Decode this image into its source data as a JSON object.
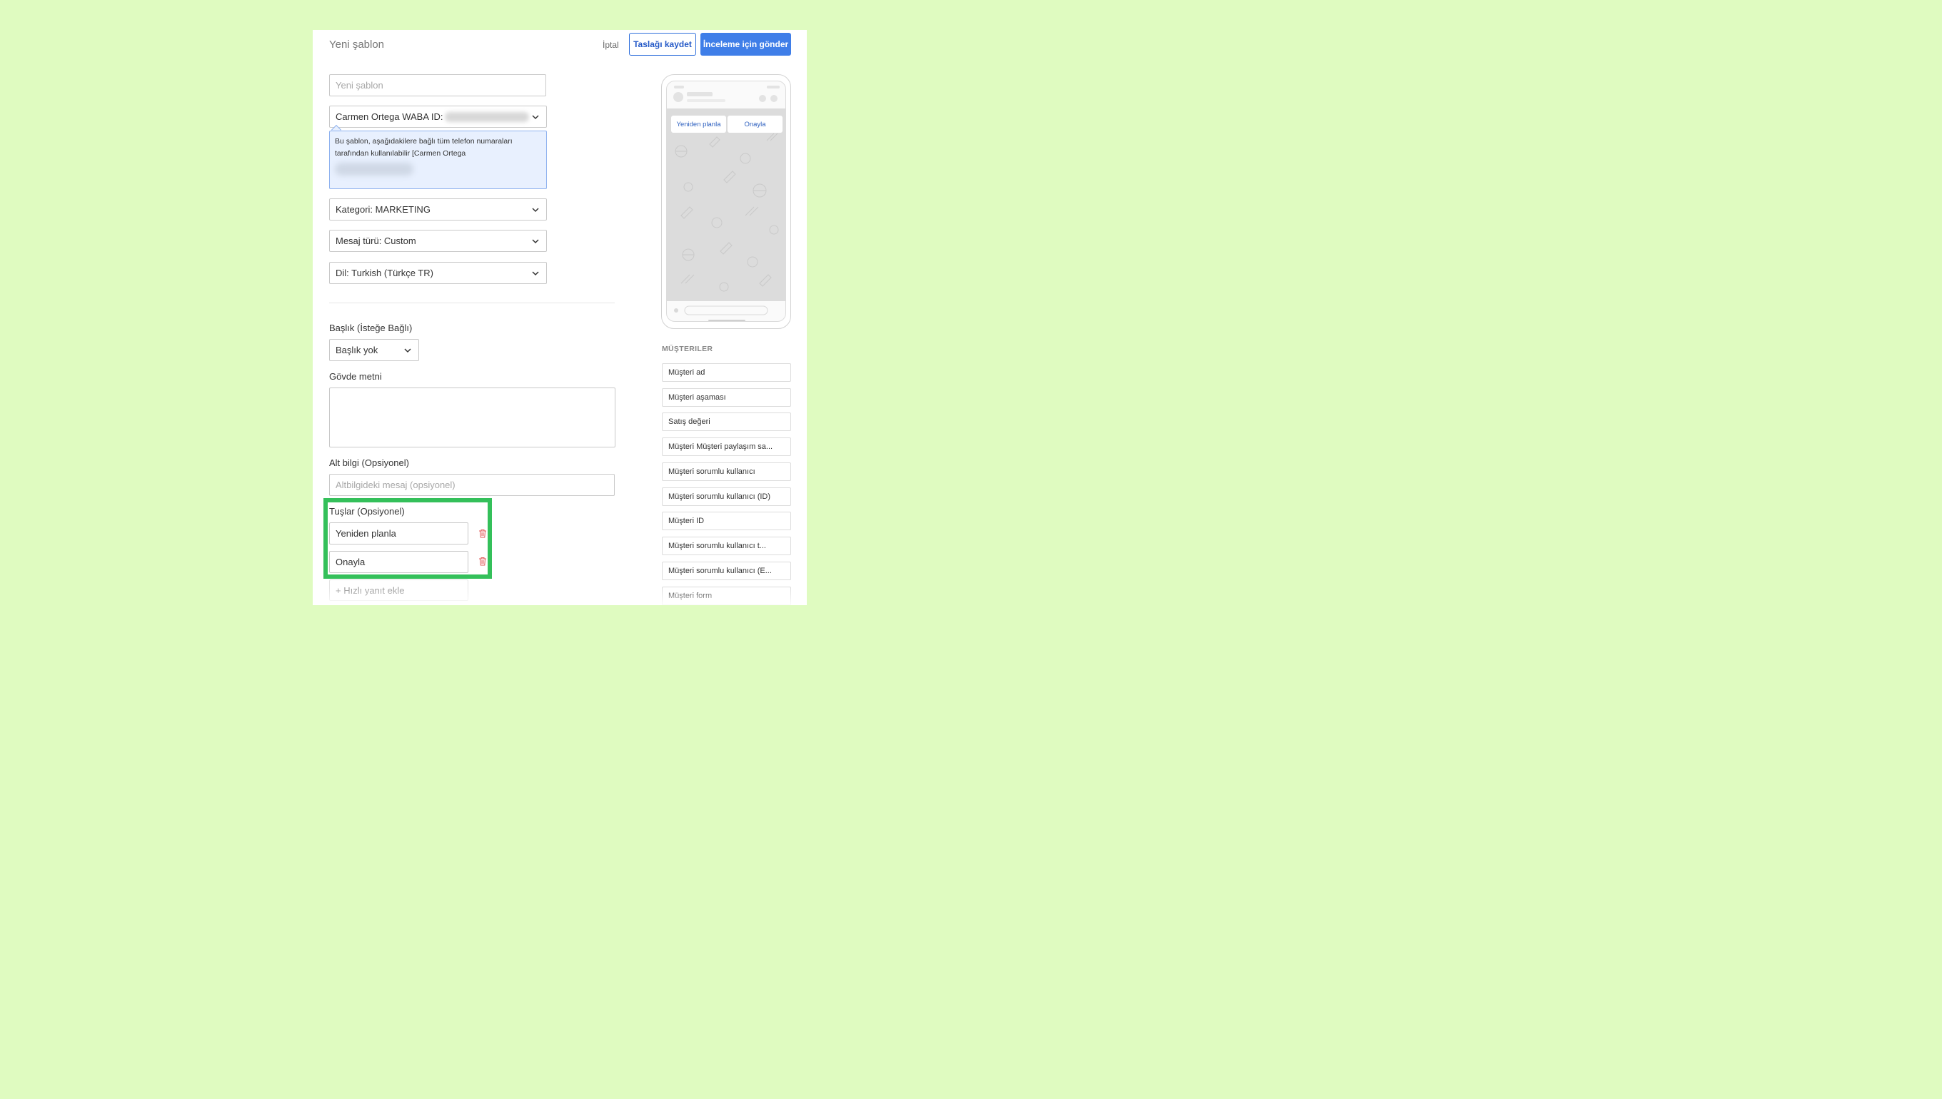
{
  "header": {
    "title": "Yeni şablon",
    "cancel_label": "İptal",
    "save_draft_label": "Taslağı kaydet",
    "submit_label": "İnceleme için gönder"
  },
  "form": {
    "name_placeholder": "Yeni şablon",
    "waba_label": "Carmen Ortega WABA ID:",
    "tooltip_text": "Bu şablon, aşağıdakilere bağlı tüm telefon numaraları tarafından kullanılabilir [Carmen Ortega",
    "category_label": "Kategori: MARKETING",
    "message_type_label": "Mesaj türü: Custom",
    "language_label": "Dil: Turkish (Türkçe TR)",
    "header_section_label": "Başlık (İsteğe Bağlı)",
    "header_select_value": "Başlık yok",
    "body_label": "Gövde metni",
    "body_value": "",
    "footer_label": "Alt bilgi (Opsiyonel)",
    "footer_placeholder": "Altbilgideki mesaj (opsiyonel)",
    "buttons_label": "Tuşlar (Opsiyonel)",
    "buttons": [
      {
        "value": "Yeniden planla"
      },
      {
        "value": "Onayla"
      }
    ],
    "add_quick_reply_label": "+ Hızlı yanıt ekle"
  },
  "preview": {
    "quick_replies": [
      "Yeniden planla",
      "Onayla"
    ]
  },
  "customers": {
    "section_title": "MÜŞTERILER",
    "items": [
      "Müşteri ad",
      "Müşteri aşaması",
      "Satış değeri",
      "Müşteri Müşteri paylaşım sa...",
      "Müşteri sorumlu kullanıcı",
      "Müşteri sorumlu kullanıcı (ID)",
      "Müşteri ID",
      "Müşteri sorumlu kullanıcı t...",
      "Müşteri sorumlu kullanıcı (E...",
      "Müşteri form"
    ]
  },
  "colors": {
    "background": "#dffbc0",
    "primary": "#3f7ee8",
    "highlight": "#34c05a",
    "danger": "#e05a5a"
  }
}
